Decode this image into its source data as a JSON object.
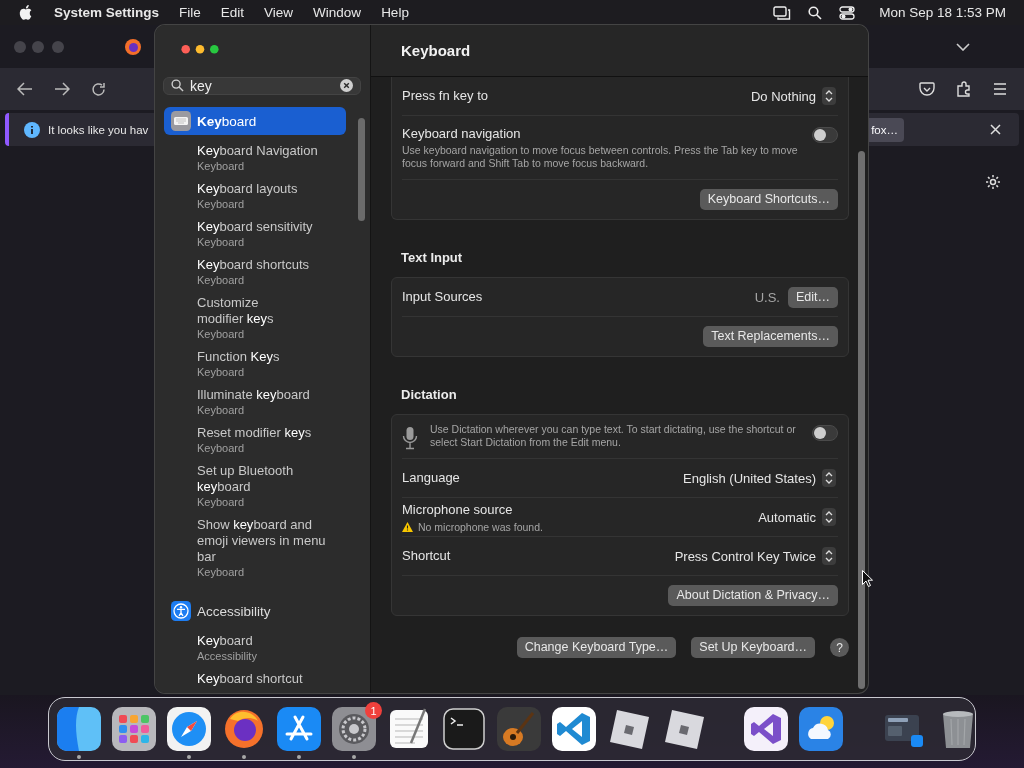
{
  "menu_bar": {
    "app": "System Settings",
    "menus": [
      "File",
      "Edit",
      "View",
      "Window",
      "Help"
    ],
    "clock": "Mon Sep 18 1:53 PM"
  },
  "browser": {
    "notification": "It looks like you hav",
    "notification_button": "fox…"
  },
  "settings": {
    "search": {
      "value": "key"
    },
    "sidebar": [
      {
        "kind": "keyboard",
        "title": "**Key**board",
        "selected": true
      },
      {
        "kind": "result",
        "title": "**Key**board Navigation",
        "subtitle": "Keyboard",
        "selected": false
      },
      {
        "kind": "result",
        "title": "**Key**board layouts",
        "subtitle": "Keyboard",
        "selected": false
      },
      {
        "kind": "result",
        "title": "**Key**board sensitivity",
        "subtitle": "Keyboard",
        "selected": false
      },
      {
        "kind": "result",
        "title": "**Key**board shortcuts",
        "subtitle": "Keyboard",
        "selected": false
      },
      {
        "kind": "result",
        "title": "Customize\nmodifier **key**s",
        "subtitle": "Keyboard",
        "selected": false
      },
      {
        "kind": "result",
        "title": "Function **Key**s",
        "subtitle": "Keyboard",
        "selected": false
      },
      {
        "kind": "result",
        "title": "Illuminate **key**board",
        "subtitle": "Keyboard",
        "selected": false
      },
      {
        "kind": "result",
        "title": "Reset modifier **key**s",
        "subtitle": "Keyboard",
        "selected": false
      },
      {
        "kind": "result",
        "title": "Set up Bluetooth\n**key**board",
        "subtitle": "Keyboard",
        "selected": false
      },
      {
        "kind": "result",
        "title": "Show **key**board and\nemoji viewers in menu\nbar",
        "subtitle": "Keyboard",
        "selected": false
      },
      {
        "kind": "accessibility",
        "title": "Accessibility",
        "selected": false
      },
      {
        "kind": "result",
        "title": "**Key**board",
        "subtitle": "Accessibility",
        "selected": false
      },
      {
        "kind": "result",
        "title": "**Key**board shortcut",
        "selected": false
      }
    ],
    "title": "Keyboard",
    "groups": [
      {
        "rows": [
          {
            "kind": "popup",
            "label": "Press fn key to",
            "value": "Do Nothing"
          },
          {
            "kind": "toggle",
            "label": "Keyboard navigation",
            "description": "Use keyboard navigation to move focus between controls. Press the Tab key to move focus forward and Shift Tab to move focus backward.",
            "on": false
          },
          {
            "kind": "button",
            "button": "Keyboard Shortcuts…"
          }
        ]
      },
      {
        "heading": "Text Input",
        "rows": [
          {
            "kind": "value_button",
            "label": "Input Sources",
            "value": "U.S.",
            "button": "Edit…"
          },
          {
            "kind": "button",
            "button": "Text Replacements…"
          }
        ]
      },
      {
        "heading": "Dictation",
        "rows": [
          {
            "kind": "mic_toggle",
            "description": "Use Dictation wherever you can type text. To start dictating, use the shortcut or select Start Dictation from the Edit menu.",
            "on": false
          },
          {
            "kind": "popup",
            "label": "Language",
            "value": "English (United States)"
          },
          {
            "kind": "popup",
            "label": "Microphone source",
            "value": "Automatic",
            "warning": "No microphone was found."
          },
          {
            "kind": "popup",
            "label": "Shortcut",
            "value": "Press Control Key Twice"
          },
          {
            "kind": "button",
            "button": "About Dictation & Privacy…"
          }
        ]
      }
    ],
    "footer_buttons": [
      "Change Keyboard Type…",
      "Set Up Keyboard…"
    ],
    "help": "?"
  },
  "dock": [
    {
      "kind": "finder",
      "running": true
    },
    {
      "kind": "launchpad",
      "running": false
    },
    {
      "kind": "safari",
      "running": true
    },
    {
      "kind": "firefox",
      "running": true
    },
    {
      "kind": "appstore",
      "running": true
    },
    {
      "kind": "settings",
      "running": true,
      "badge": "1"
    },
    {
      "kind": "textedit",
      "running": false
    },
    {
      "kind": "terminal",
      "running": false
    },
    {
      "kind": "guitar",
      "running": false
    },
    {
      "kind": "vscode",
      "running": false
    },
    {
      "kind": "roblox",
      "running": false
    },
    {
      "kind": "roblox",
      "running": false
    },
    {
      "kind": "separator"
    },
    {
      "kind": "vstudio",
      "running": false
    },
    {
      "kind": "weather",
      "running": false
    },
    {
      "kind": "separator"
    },
    {
      "kind": "stack",
      "running": false
    },
    {
      "kind": "trash",
      "running": false
    }
  ]
}
